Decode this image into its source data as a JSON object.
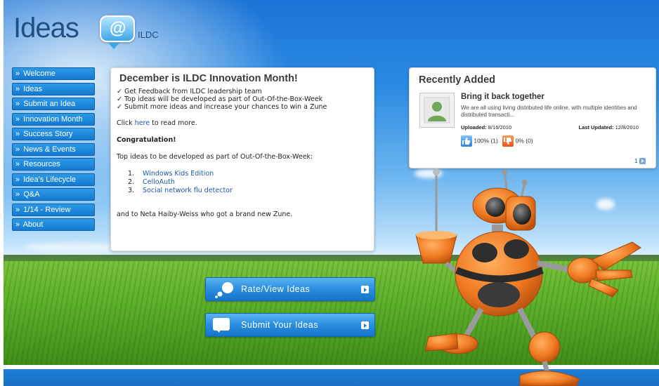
{
  "logo": {
    "main": "Ideas",
    "symbol": "@",
    "sub": "ILDC"
  },
  "nav": {
    "items": [
      {
        "label": "Welcome"
      },
      {
        "label": "Ideas"
      },
      {
        "label": "Submit an Idea"
      },
      {
        "label": "Innovation Month"
      },
      {
        "label": "Success Story"
      },
      {
        "label": "News & Events"
      },
      {
        "label": "Resources"
      },
      {
        "label": "Idea's Lifecycle"
      },
      {
        "label": "Q&A"
      },
      {
        "label": "1/14 - Review"
      },
      {
        "label": "About"
      }
    ],
    "prefix": "»"
  },
  "main": {
    "title": "December is ILDC Innovation Month!",
    "checks": [
      "✓ Get Feedback from ILDC leadership team",
      "✓ Top ideas will be developed as part of Out-Of-the-Box-Week",
      "✓ Submit more ideas and increase your chances to win a Zune"
    ],
    "click_prefix": "Click ",
    "click_link": "here",
    "click_suffix": " to read more.",
    "congrats": "Congratulation!",
    "top_ideas_text": "Top ideas to be developed as part of Out-Of-the-Box-Week:",
    "winners": [
      {
        "num": "1.",
        "label": "Windows Kids Edition"
      },
      {
        "num": "2.",
        "label": "CelloAuth"
      },
      {
        "num": "3.",
        "label": "Social network flu detector"
      }
    ],
    "closing": "and to Neta Haiby-Weiss who got a brand new Zune."
  },
  "buttons": {
    "rate": "Rate/View Ideas",
    "submit": "Submit Your Ideas"
  },
  "recent": {
    "title": "Recently Added",
    "idea_title": "Bring it back together",
    "idea_desc": "We are all using living distributed life online, with multiple identities and distributed transacti...",
    "uploaded_label": "Uploaded:",
    "uploaded_value": "8/16/2010",
    "updated_label": "Last Updated:",
    "updated_value": "12/8/2010",
    "up_votes": "100% (1)",
    "down_votes": "0% (0)",
    "page": "1"
  },
  "colors": {
    "nav_button": "#1a85da",
    "title_text": "#3c3c3c",
    "link": "#1d57a6",
    "robot_orange": "#f07a22"
  },
  "icons": [
    "at-bubble-icon",
    "rate-bubbles-icon",
    "speech-bubble-icon",
    "arrow-right-icon",
    "avatar-icon",
    "thumbs-up-icon",
    "thumbs-down-icon",
    "next-page-icon"
  ]
}
